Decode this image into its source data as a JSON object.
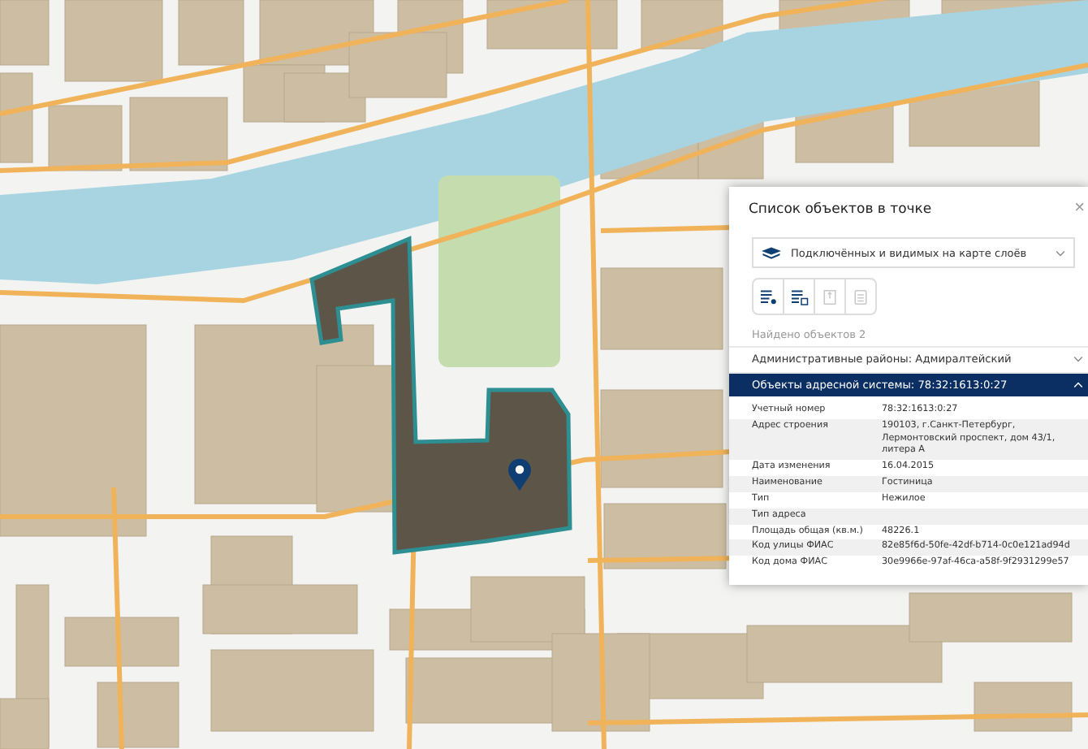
{
  "panel": {
    "title": "Список объектов в точке",
    "close": "×",
    "layer_select": {
      "value": "Подключённых и видимых на карте слоёв"
    },
    "tools": [
      {
        "kind": "list-pin",
        "disabled": false
      },
      {
        "kind": "list-grid",
        "disabled": false
      },
      {
        "kind": "frame",
        "disabled": true
      },
      {
        "kind": "document",
        "disabled": true
      }
    ],
    "found": "Найдено объектов 2",
    "groups": [
      {
        "label": "Административные районы: Адмиралтейский",
        "selected": false,
        "expanded": false
      },
      {
        "label": "Объекты адресной системы: 78:32:1613:0:27",
        "selected": true,
        "expanded": true
      }
    ],
    "properties": [
      {
        "label": "Учетный номер",
        "value": "78:32:1613:0:27"
      },
      {
        "label": "Адрес строения",
        "value": "190103, г.Санкт-Петербург, Лермонтовский проспект, дом 43/1, литера А"
      },
      {
        "label": "Дата изменения",
        "value": "16.04.2015"
      },
      {
        "label": "Наименование",
        "value": "Гостиница"
      },
      {
        "label": "Тип",
        "value": "Нежилое"
      },
      {
        "label": "Тип адреса"
      },
      {
        "label": "Площадь общая (кв.м.)",
        "value": "48226.1"
      },
      {
        "label": "Код улицы ФИАС",
        "value": "82e85f6d-50fe-42df-b714-0c0e121ad94d"
      },
      {
        "label": "Код дома ФИАС",
        "value": "30e9966e-97af-46ca-a58f-9f2931299e57"
      }
    ]
  }
}
